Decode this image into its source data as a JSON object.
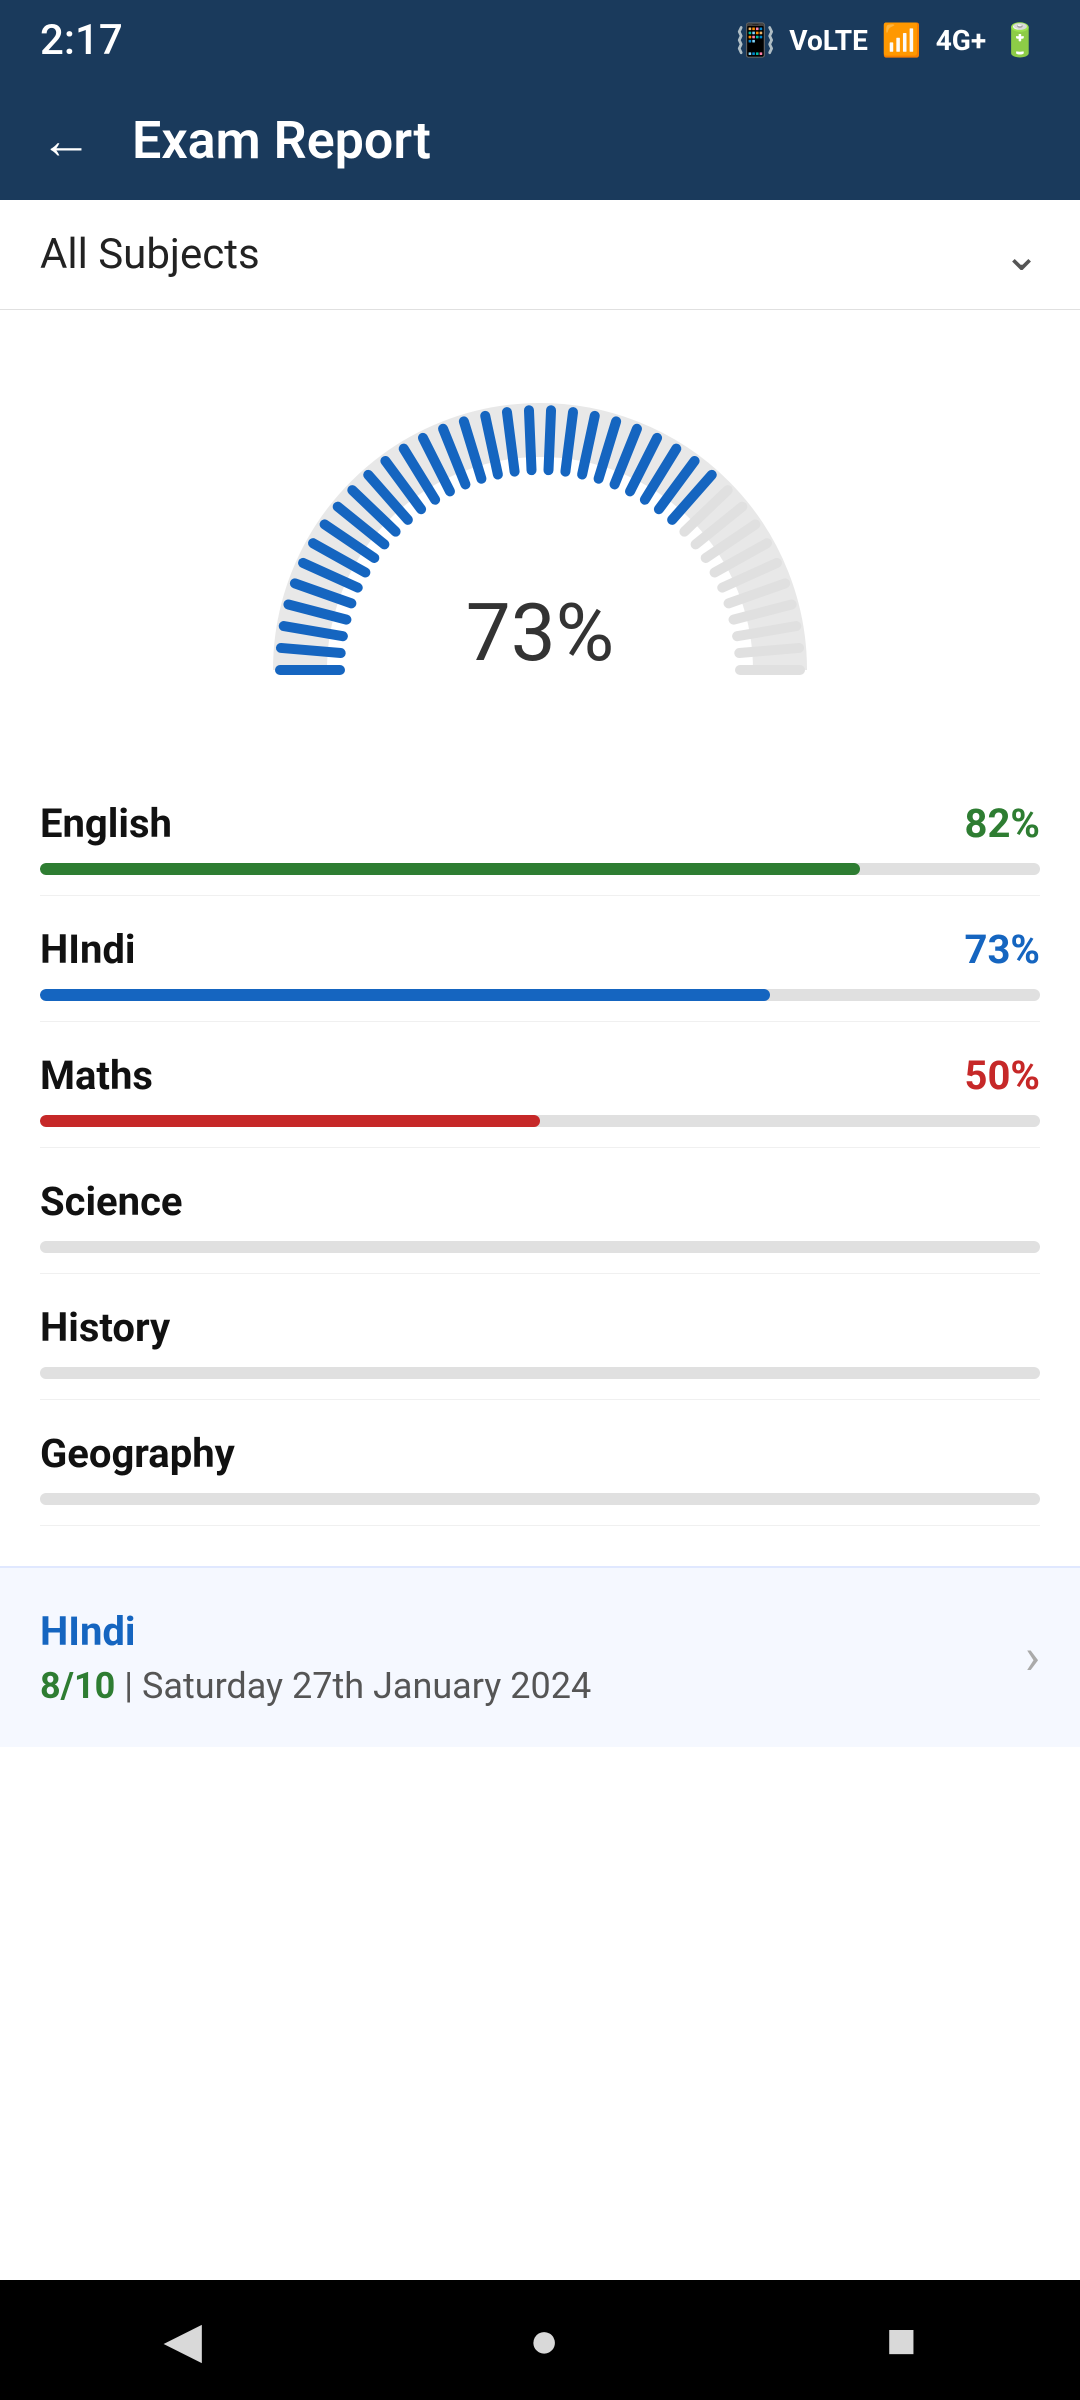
{
  "statusBar": {
    "time": "2:17",
    "icons": [
      "vibrate",
      "volte",
      "wifi",
      "4g",
      "signal",
      "battery"
    ]
  },
  "header": {
    "backLabel": "←",
    "title": "Exam Report"
  },
  "subjectDropdown": {
    "label": "All Subjects",
    "chevron": "⌄"
  },
  "gauge": {
    "percent": "73%",
    "value": 73
  },
  "subjects": [
    {
      "name": "English",
      "score": "82%",
      "value": 82,
      "colorClass": "score-green",
      "fillClass": "fill-green"
    },
    {
      "name": "HIndi",
      "score": "73%",
      "value": 73,
      "colorClass": "score-blue",
      "fillClass": "fill-blue"
    },
    {
      "name": "Maths",
      "score": "50%",
      "value": 50,
      "colorClass": "score-red",
      "fillClass": "fill-red"
    },
    {
      "name": "Science",
      "score": "",
      "value": 0,
      "colorClass": "",
      "fillClass": "fill-none"
    },
    {
      "name": "History",
      "score": "",
      "value": 0,
      "colorClass": "",
      "fillClass": "fill-none"
    },
    {
      "name": "Geography",
      "score": "",
      "value": 0,
      "colorClass": "",
      "fillClass": "fill-none"
    }
  ],
  "examCard": {
    "subject": "HIndi",
    "score": "8/10",
    "separator": " | ",
    "date": "Saturday 27th January 2024"
  },
  "bottomNav": {
    "back": "◀",
    "home": "●",
    "square": "■"
  }
}
